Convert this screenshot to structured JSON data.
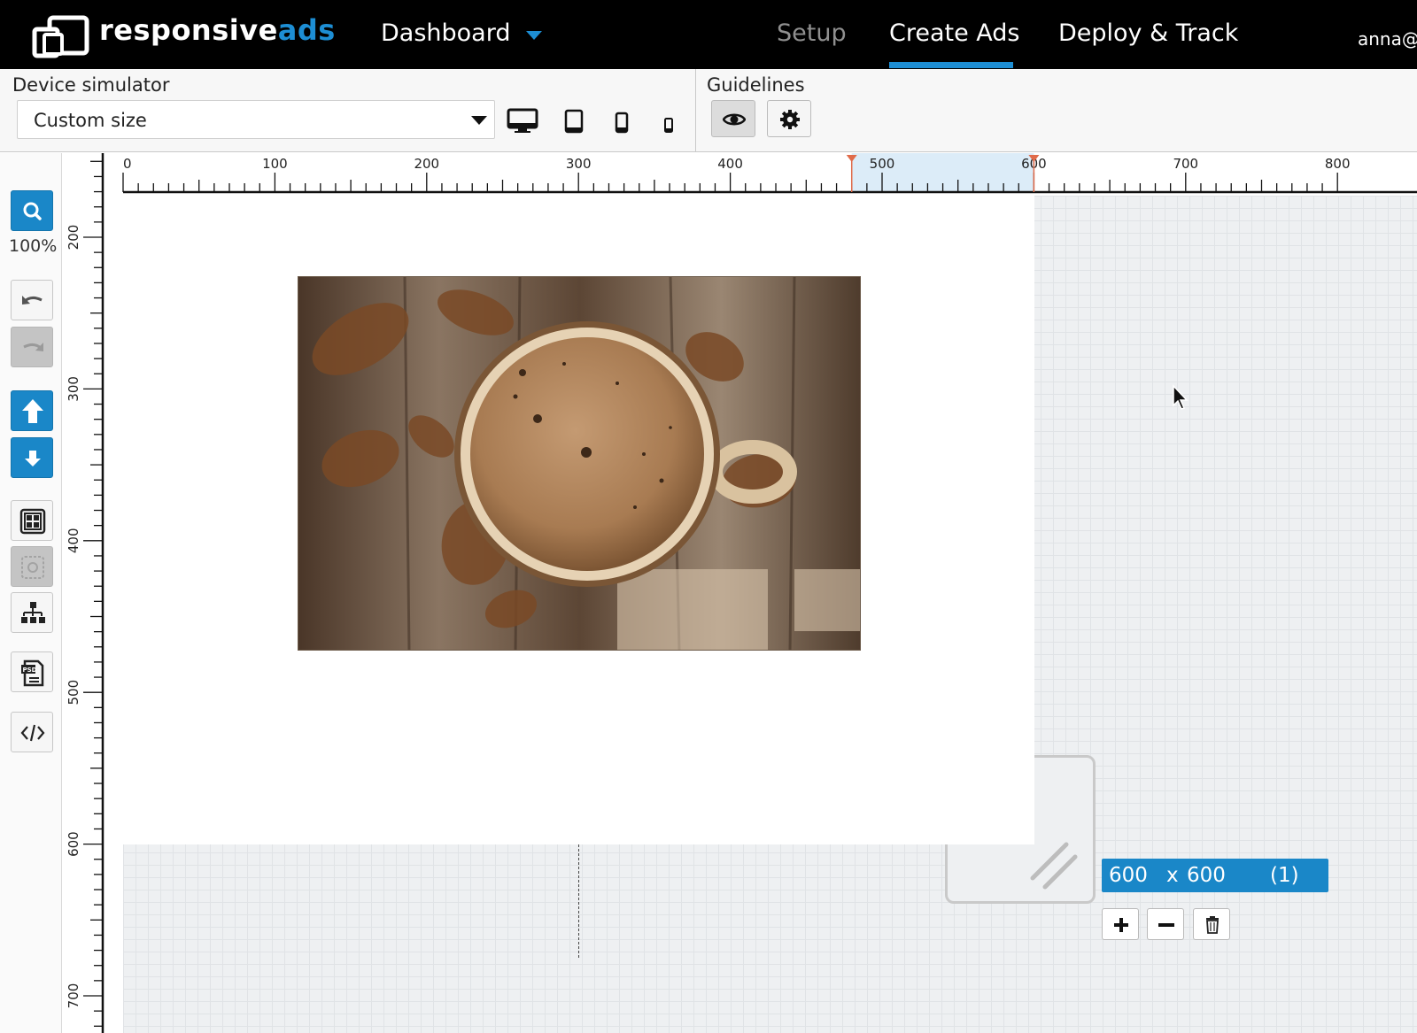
{
  "app": {
    "brand_main": "responsive",
    "brand_accent": "ads",
    "logo_icon": "responsiveads-logo-icon",
    "accent_color": "#1d8ed4"
  },
  "nav": {
    "dashboard": "Dashboard",
    "tabs": [
      {
        "label": "Setup",
        "state": "disabled"
      },
      {
        "label": "Create Ads",
        "state": "active"
      },
      {
        "label": "Deploy & Track",
        "state": "normal"
      }
    ],
    "user": "anna@"
  },
  "toolbar": {
    "device_label": "Device simulator",
    "device_select_value": "Custom size",
    "device_icons": [
      "desktop-icon",
      "tablet-icon",
      "phone-icon",
      "small-phone-icon"
    ],
    "guidelines_label": "Guidelines",
    "guideline_icons": [
      "eye-icon",
      "gear-icon"
    ]
  },
  "tools": {
    "zoom_level": "100%",
    "icons": [
      "search-icon",
      "undo-icon",
      "redo-icon",
      "arrow-up-icon",
      "arrow-down-icon",
      "grid-layout-icon",
      "screenshot-icon",
      "hierarchy-icon",
      "psd-import-icon",
      "code-icon"
    ]
  },
  "rulers": {
    "horizontal_labels": [
      "0",
      "100",
      "200",
      "300",
      "400",
      "500",
      "600",
      "700",
      "800"
    ],
    "vertical_labels": [
      "200",
      "300",
      "400",
      "500",
      "600",
      "700"
    ],
    "selection_start": 480,
    "selection_end": 600
  },
  "canvas": {
    "image": "coffee-cup-photo",
    "size_width": "600",
    "size_separator": "x",
    "size_height": "600",
    "size_count": "(1)",
    "size_buttons": [
      "plus-icon",
      "minus-icon",
      "trash-icon"
    ]
  }
}
